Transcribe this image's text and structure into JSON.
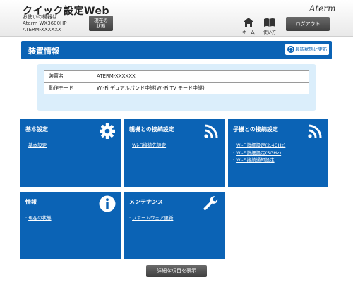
{
  "header": {
    "app_title": "クイック設定Web",
    "device_label": "お使いの機器は",
    "device_model": "Aterm WX3600HP",
    "device_name": "ATERM-XXXXXX",
    "status_button": [
      "現在の",
      "状態"
    ],
    "brand": "Aterm",
    "home_label": "ホーム",
    "help_label": "使い方",
    "logout_label": "ログアウト"
  },
  "device_info": {
    "title": "装置情報",
    "refresh_label": "最新状態に更新",
    "rows": [
      {
        "key": "装置名",
        "value": "ATERM-XXXXXX"
      },
      {
        "key": "動作モード",
        "value": "Wi-Fi デュアルバンド中継(Wi-Fi TV モード中継)"
      }
    ]
  },
  "tiles": {
    "basic": {
      "title": "基本設定",
      "icon": "gear-icon",
      "links": [
        "基本設定"
      ]
    },
    "parent": {
      "title": "親機との接続設定",
      "icon": "wifi-icon",
      "links": [
        "Wi-Fi接続先設定"
      ]
    },
    "child": {
      "title": "子機との接続設定",
      "icon": "wifi-icon",
      "links": [
        "Wi-Fi詳細設定(2.4GHz)",
        "Wi-Fi詳細設定(5GHz)",
        "Wi-Fi接続通知設定"
      ]
    },
    "info": {
      "title": "情報",
      "icon": "info-icon",
      "links": [
        "現在の状態"
      ]
    },
    "maintenance": {
      "title": "メンテナンス",
      "icon": "wrench-icon",
      "links": [
        "ファームウェア更新"
      ]
    }
  },
  "show_more_label": "詳細な項目を表示",
  "colors": {
    "accent": "#0b63b5",
    "panel_bg": "#dbeefb",
    "button_dark": "#4a4a4a"
  }
}
